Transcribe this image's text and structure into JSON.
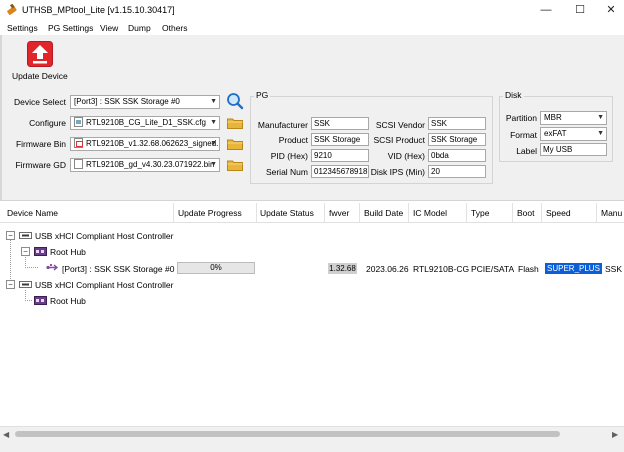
{
  "window": {
    "title": "UTHSB_MPtool_Lite [v1.15.10.30417]",
    "minimize_glyph": "—",
    "maximize_glyph": "☐",
    "close_glyph": "✕"
  },
  "menu": [
    "Settings",
    "PG Settings",
    "View",
    "Dump",
    "Others"
  ],
  "toolbar": {
    "update_label": "Update Device",
    "update_icon": "upload-arrow-icon",
    "update_color": "#e0262b"
  },
  "device_config": {
    "device_select_label": "Device Select",
    "device_select_value": "[Port3] : SSK SSK Storage #0",
    "configure_label": "Configure",
    "configure_value": "RTL9210B_CG_Lite_D1_SSK.cfg",
    "firmware_bin_label": "Firmware Bin",
    "firmware_bin_value": "RTL9210B_v1.32.68.062623_signed.",
    "firmware_gd_label": "Firmware GD",
    "firmware_gd_value": "RTL9210B_gd_v4.30.23.071922.bin"
  },
  "pg": {
    "title": "PG",
    "manufacturer_label": "Manufacturer",
    "manufacturer_value": "SSK",
    "product_label": "Product",
    "product_value": "SSK Storage",
    "pid_label": "PID (Hex)",
    "pid_value": "9210",
    "serial_label": "Serial Num",
    "serial_value": "012345678918",
    "scsi_vendor_label": "SCSI Vendor",
    "scsi_vendor_value": "SSK",
    "scsi_product_label": "SCSI Product",
    "scsi_product_value": "SSK Storage",
    "vid_label": "VID (Hex)",
    "vid_value": "0bda",
    "disk_ips_label": "Disk IPS (Min)",
    "disk_ips_value": "20"
  },
  "disk": {
    "title": "Disk",
    "partition_label": "Partition",
    "partition_value": "MBR",
    "format_label": "Format",
    "format_value": "exFAT",
    "label_label": "Label",
    "label_value": "My USB"
  },
  "list": {
    "columns": [
      "Device Name",
      "Update Progress",
      "Update Status",
      "fwver",
      "Build Date",
      "IC Model",
      "Type",
      "Boot",
      "Speed",
      "Manu"
    ],
    "controller1": "USB xHCI Compliant Host Controller",
    "hub1": "Root Hub",
    "device": {
      "name": "[Port3] : SSK SSK Storage #0",
      "progress_text": "0%",
      "progress": 0,
      "status": "",
      "fwver": "1.32.68",
      "build_date": "2023.06.26",
      "ic_model": "RTL9210B-CG",
      "type": "PCIE/SATA",
      "boot": "Flash",
      "speed": "SUPER_PLUS",
      "manu": "SSK"
    },
    "controller2": "USB xHCI Compliant Host Controller",
    "hub2": "Root Hub",
    "speed_highlight_color": "#0a5fd8"
  },
  "scrollbar": {
    "left_glyph": "◀",
    "right_glyph": "▶"
  }
}
